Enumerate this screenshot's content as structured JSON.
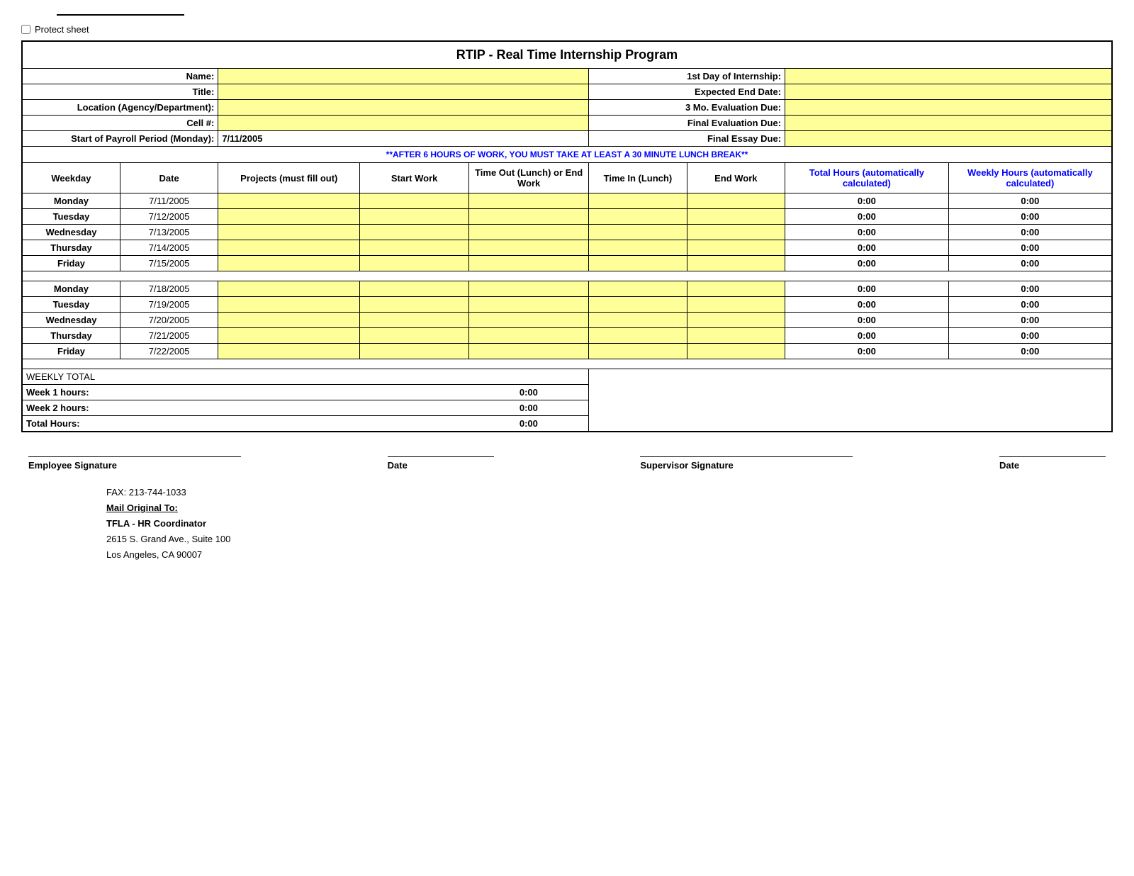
{
  "page": {
    "protect_sheet_label": "Protect sheet",
    "title": "RTIP - Real Time Internship Program",
    "fields": {
      "name_label": "Name:",
      "title_label": "Title:",
      "location_label": "Location (Agency/Department):",
      "cell_label": "Cell #:",
      "payroll_label": "Start of Payroll Period (Monday):",
      "payroll_value": "7/11/2005",
      "first_day_label": "1st Day of Internship:",
      "expected_end_label": "Expected End Date:",
      "eval_3mo_label": "3 Mo. Evaluation Due:",
      "final_eval_label": "Final Evaluation Due:",
      "final_essay_label": "Final Essay Due:"
    },
    "warning": "**AFTER 6 HOURS OF WORK, YOU MUST TAKE AT LEAST A 30 MINUTE LUNCH BREAK**",
    "column_headers": {
      "weekday": "Weekday",
      "date": "Date",
      "projects": "Projects (must fill out)",
      "start_work": "Start Work",
      "time_out": "Time Out (Lunch) or End Work",
      "time_in": "Time In (Lunch)",
      "end_work": "End Work",
      "total_hours": "Total Hours (automatically calculated)",
      "weekly_hours": "Weekly Hours (automatically calculated)"
    },
    "week1": [
      {
        "day": "Monday",
        "date": "7/11/2005",
        "total": "0:00",
        "weekly": "0:00"
      },
      {
        "day": "Tuesday",
        "date": "7/12/2005",
        "total": "0:00",
        "weekly": "0:00"
      },
      {
        "day": "Wednesday",
        "date": "7/13/2005",
        "total": "0:00",
        "weekly": "0:00"
      },
      {
        "day": "Thursday",
        "date": "7/14/2005",
        "total": "0:00",
        "weekly": "0:00"
      },
      {
        "day": "Friday",
        "date": "7/15/2005",
        "total": "0:00",
        "weekly": "0:00"
      }
    ],
    "week2": [
      {
        "day": "Monday",
        "date": "7/18/2005",
        "total": "0:00",
        "weekly": "0:00"
      },
      {
        "day": "Tuesday",
        "date": "7/19/2005",
        "total": "0:00",
        "weekly": "0:00"
      },
      {
        "day": "Wednesday",
        "date": "7/20/2005",
        "total": "0:00",
        "weekly": "0:00"
      },
      {
        "day": "Thursday",
        "date": "7/21/2005",
        "total": "0:00",
        "weekly": "0:00"
      },
      {
        "day": "Friday",
        "date": "7/22/2005",
        "total": "0:00",
        "weekly": "0:00"
      }
    ],
    "weekly_total_label": "WEEKLY TOTAL",
    "summary": {
      "week1_label": "Week 1 hours:",
      "week1_value": "0:00",
      "week2_label": "Week 2 hours:",
      "week2_value": "0:00",
      "total_label": "Total Hours:",
      "total_value": "0:00"
    },
    "signature": {
      "employee_label": "Employee Signature",
      "date_label": "Date",
      "supervisor_label": "Supervisor Signature",
      "date2_label": "Date"
    },
    "footer": {
      "fax": "FAX:  213-744-1033",
      "mail_label": "Mail Original To:",
      "org": "TFLA - HR Coordinator",
      "address1": "2615 S. Grand Ave., Suite 100",
      "address2": "Los Angeles, CA 90007"
    }
  }
}
